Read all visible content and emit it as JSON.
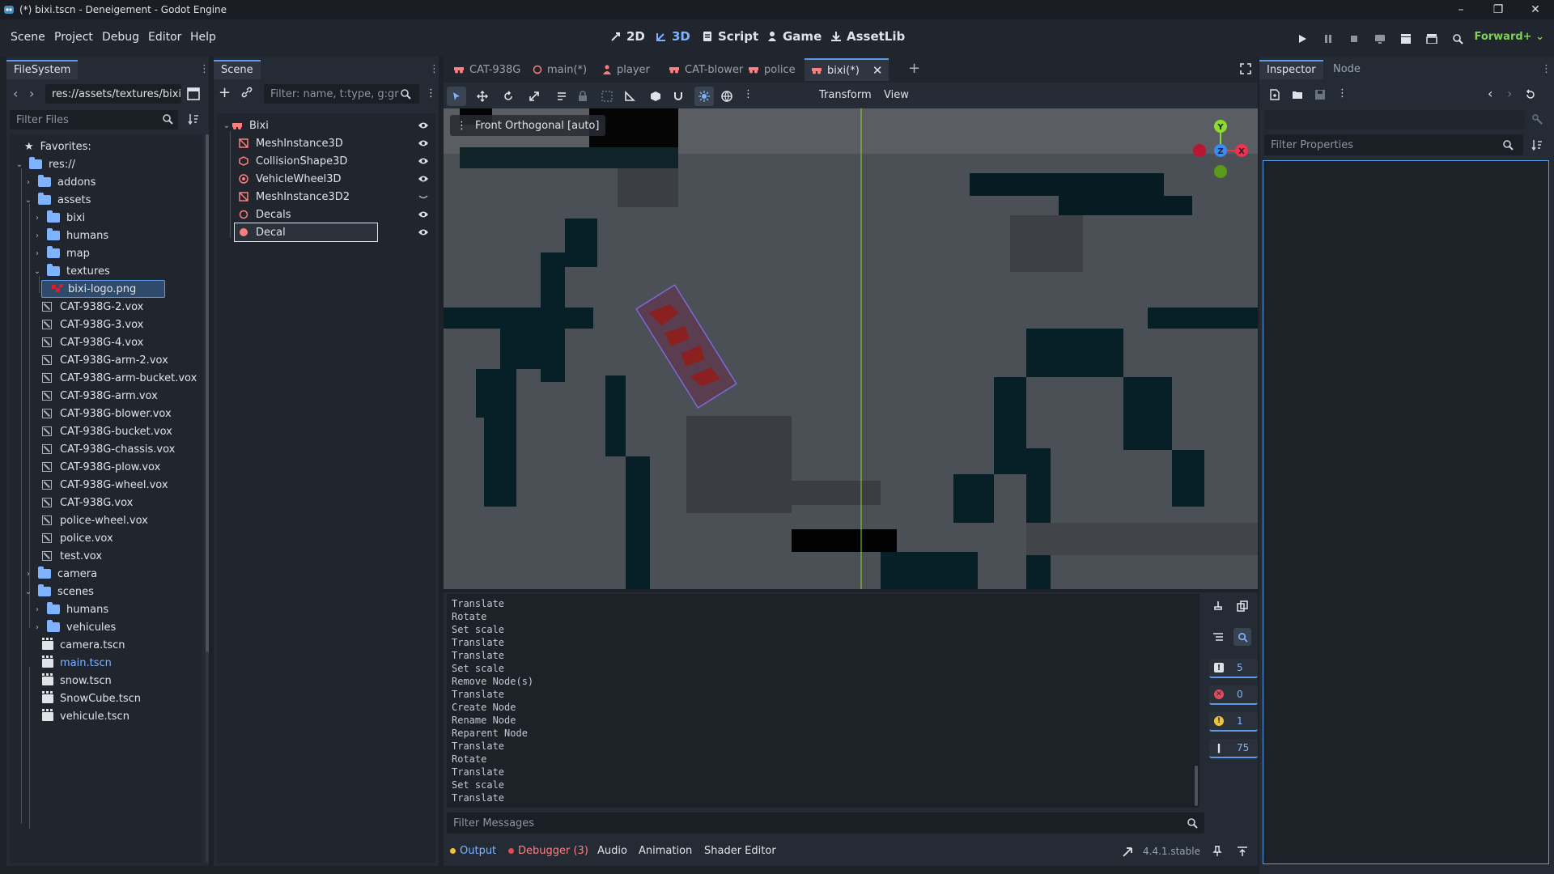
{
  "window": {
    "title": "(*) bixi.tscn - Deneigement - Godot Engine",
    "controls": [
      "–",
      "❐",
      "✕"
    ]
  },
  "menu": {
    "items": [
      "Scene",
      "Project",
      "Debug",
      "Editor",
      "Help"
    ]
  },
  "workspaces": {
    "items": [
      "2D",
      "3D",
      "Script",
      "Game",
      "AssetLib"
    ],
    "active": "3D"
  },
  "renderer": "Forward+",
  "filesystem": {
    "tab": "FileSystem",
    "path": "res://assets/textures/bixi",
    "filter_placeholder": "Filter Files",
    "favorites_label": "Favorites:",
    "root_label": "res://",
    "tree": [
      {
        "label": "addons",
        "type": "folder",
        "depth": 1,
        "expanded": false
      },
      {
        "label": "assets",
        "type": "folder",
        "depth": 1,
        "expanded": true
      },
      {
        "label": "bixi",
        "type": "folder",
        "depth": 2,
        "expanded": false
      },
      {
        "label": "humans",
        "type": "folder",
        "depth": 2,
        "expanded": false
      },
      {
        "label": "map",
        "type": "folder",
        "depth": 2,
        "expanded": false
      },
      {
        "label": "textures",
        "type": "folder",
        "depth": 2,
        "expanded": true
      },
      {
        "label": "bixi-logo.png",
        "type": "image",
        "depth": 3,
        "selected": true
      },
      {
        "label": "CAT-938G-2.vox",
        "type": "vox",
        "depth": 2
      },
      {
        "label": "CAT-938G-3.vox",
        "type": "vox",
        "depth": 2
      },
      {
        "label": "CAT-938G-4.vox",
        "type": "vox",
        "depth": 2
      },
      {
        "label": "CAT-938G-arm-2.vox",
        "type": "vox",
        "depth": 2
      },
      {
        "label": "CAT-938G-arm-bucket.vox",
        "type": "vox",
        "depth": 2
      },
      {
        "label": "CAT-938G-arm.vox",
        "type": "vox",
        "depth": 2
      },
      {
        "label": "CAT-938G-blower.vox",
        "type": "vox",
        "depth": 2
      },
      {
        "label": "CAT-938G-bucket.vox",
        "type": "vox",
        "depth": 2
      },
      {
        "label": "CAT-938G-chassis.vox",
        "type": "vox",
        "depth": 2
      },
      {
        "label": "CAT-938G-plow.vox",
        "type": "vox",
        "depth": 2
      },
      {
        "label": "CAT-938G-wheel.vox",
        "type": "vox",
        "depth": 2
      },
      {
        "label": "CAT-938G.vox",
        "type": "vox",
        "depth": 2
      },
      {
        "label": "police-wheel.vox",
        "type": "vox",
        "depth": 2
      },
      {
        "label": "police.vox",
        "type": "vox",
        "depth": 2
      },
      {
        "label": "test.vox",
        "type": "vox",
        "depth": 2
      },
      {
        "label": "camera",
        "type": "folder",
        "depth": 1,
        "expanded": false
      },
      {
        "label": "scenes",
        "type": "folder",
        "depth": 1,
        "expanded": true
      },
      {
        "label": "humans",
        "type": "folder",
        "depth": 2,
        "expanded": false
      },
      {
        "label": "vehicules",
        "type": "folder",
        "depth": 2,
        "expanded": false
      },
      {
        "label": "camera.tscn",
        "type": "scene",
        "depth": 2
      },
      {
        "label": "main.tscn",
        "type": "scene",
        "depth": 2,
        "highlight": true
      },
      {
        "label": "snow.tscn",
        "type": "scene",
        "depth": 2
      },
      {
        "label": "SnowCube.tscn",
        "type": "scene",
        "depth": 2
      },
      {
        "label": "vehicule.tscn",
        "type": "scene",
        "depth": 2
      }
    ]
  },
  "scene": {
    "tab": "Scene",
    "filter_placeholder": "Filter: name, t:type, g:gr",
    "nodes": [
      {
        "label": "Bixi",
        "icon": "vehicle-body-icon",
        "depth": 0,
        "visibility": "visible"
      },
      {
        "label": "MeshInstance3D",
        "icon": "mesh-icon",
        "depth": 1,
        "visibility": "visible"
      },
      {
        "label": "CollisionShape3D",
        "icon": "collision-icon",
        "depth": 1,
        "visibility": "visible"
      },
      {
        "label": "VehicleWheel3D",
        "icon": "wheel-icon",
        "depth": 1,
        "visibility": "visible"
      },
      {
        "label": "MeshInstance3D2",
        "icon": "mesh-icon",
        "depth": 1,
        "visibility": "hidden"
      },
      {
        "label": "Decals",
        "icon": "node3d-icon",
        "depth": 1,
        "visibility": "visible"
      },
      {
        "label": "Decal",
        "icon": "decal-icon",
        "depth": 1,
        "visibility": "visible",
        "selected": true
      }
    ]
  },
  "editor_tabs": [
    {
      "label": "CAT-938G",
      "icon": "vehicle-icon"
    },
    {
      "label": "main(*)",
      "icon": "node-icon"
    },
    {
      "label": "player",
      "icon": "character-icon"
    },
    {
      "label": "CAT-blower",
      "icon": "vehicle-icon"
    },
    {
      "label": "police",
      "icon": "vehicle-icon"
    },
    {
      "label": "bixi(*)",
      "icon": "vehicle-icon",
      "active": true
    }
  ],
  "viewport": {
    "menus": [
      "Transform",
      "View"
    ],
    "label": "Front Orthogonal [auto]",
    "gizmo": {
      "y": "Y",
      "z": "Z",
      "x": "X"
    }
  },
  "output": {
    "log_lines": [
      "Translate",
      "Rotate",
      "Set scale",
      "Translate",
      "Translate",
      "Set scale",
      "Remove Node(s)",
      "Translate",
      "Create Node",
      "Rename Node",
      "Reparent Node",
      "Translate",
      "Rotate",
      "Translate",
      "Set scale",
      "Translate"
    ],
    "filter_placeholder": "Filter Messages",
    "counts": {
      "messages": "5",
      "errors": "0",
      "warnings": "1",
      "editor": "75"
    },
    "bottom_tabs": {
      "output": "Output",
      "debugger": "Debugger (3)",
      "audio": "Audio",
      "animation": "Animation",
      "shader": "Shader Editor"
    },
    "version": "4.4.1.stable"
  },
  "inspector": {
    "tabs": [
      "Inspector",
      "Node"
    ],
    "filter_placeholder": "Filter Properties"
  },
  "colors": {
    "accent": "#5c9ce6",
    "node_red": "#fc7f7f",
    "decal_red": "#8b2020",
    "gizmo_y": "#8bdc2e",
    "gizmo_x": "#f03250",
    "gizmo_z": "#3c8cf0"
  }
}
